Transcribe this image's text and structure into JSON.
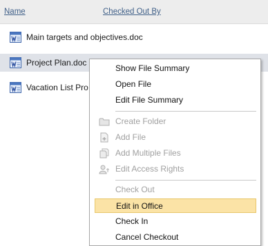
{
  "columns": {
    "name": "Name",
    "checked_out_by": "Checked Out By"
  },
  "files": [
    {
      "name": "Main targets and objectives.doc",
      "icon": "word-doc-icon"
    },
    {
      "name": "Project Plan.doc",
      "icon": "word-doc-icon"
    },
    {
      "name": "Vacation List Pro",
      "icon": "word-doc-icon"
    }
  ],
  "context_menu": {
    "groups": [
      [
        {
          "label": "Show File Summary",
          "enabled": true
        },
        {
          "label": "Open File",
          "enabled": true
        },
        {
          "label": "Edit File Summary",
          "enabled": true
        }
      ],
      [
        {
          "label": "Create Folder",
          "enabled": false,
          "icon": "folder-icon"
        },
        {
          "label": "Add File",
          "enabled": false,
          "icon": "add-file-icon"
        },
        {
          "label": "Add Multiple Files",
          "enabled": false,
          "icon": "add-multiple-files-icon"
        },
        {
          "label": "Edit Access Rights",
          "enabled": false,
          "icon": "access-rights-icon"
        }
      ],
      [
        {
          "label": "Check Out",
          "enabled": false
        },
        {
          "label": "Edit in Office",
          "enabled": true,
          "highlighted": true
        },
        {
          "label": "Check In",
          "enabled": true
        },
        {
          "label": "Cancel Checkout",
          "enabled": true
        }
      ]
    ]
  },
  "colors": {
    "highlight": "#fbe3a6",
    "selected_row": "#dfe2e8",
    "link": "#3f5f88"
  }
}
